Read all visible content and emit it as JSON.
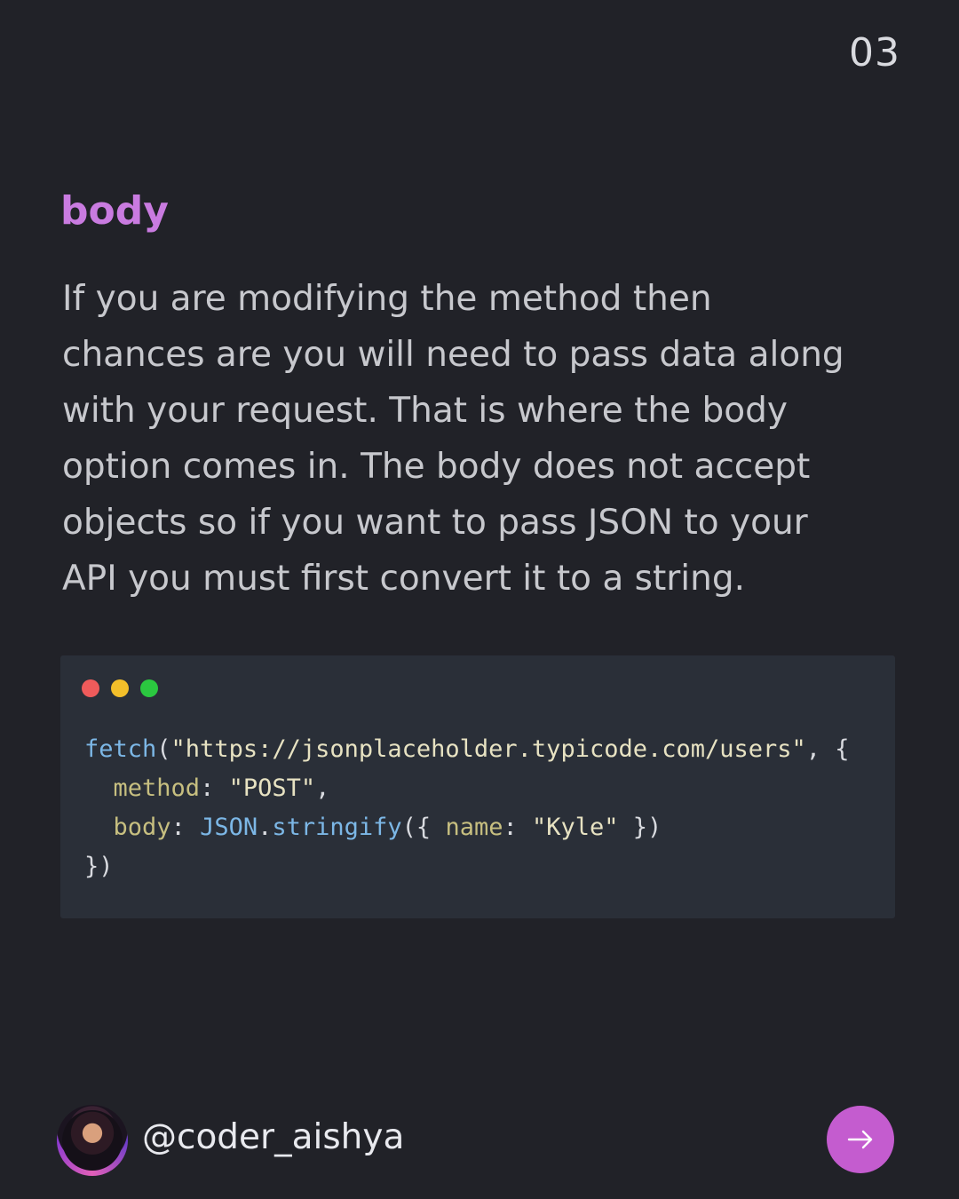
{
  "page_number": "03",
  "section": {
    "title": "body",
    "description_lines": [
      "If you are modifying the method then",
      "chances are you will need to pass data along",
      "with your request. That is where the body",
      "option comes in. The body does not accept",
      "objects so if you want to pass JSON to your",
      "API you must first convert it to a string."
    ]
  },
  "code_window": {
    "controls": [
      "close-dot",
      "minimize-dot",
      "maximize-dot"
    ],
    "colors": {
      "close": "#ef5b5b",
      "minimize": "#f3bf2a",
      "maximize": "#2bc840"
    },
    "lines": {
      "l1": {
        "fn": "fetch",
        "open": "(",
        "url": "\"https://jsonplaceholder.typicode.com/users\"",
        "rest": ", {"
      },
      "l2": {
        "indent": "  ",
        "key": "method",
        "sep": ": ",
        "value": "\"POST\"",
        "end": ","
      },
      "l3": {
        "indent": "  ",
        "key": "body",
        "sep": ": ",
        "obj": "JSON",
        "dot": ".",
        "method": "stringify",
        "open": "({ ",
        "inner_key": "name",
        "inner_sep": ": ",
        "inner_value": "\"Kyle\"",
        "close": " })"
      },
      "l4": {
        "text": "})"
      }
    }
  },
  "footer": {
    "handle": "@coder_aishya",
    "avatar": "profile-avatar",
    "next_icon": "arrow-right-icon",
    "accent": "#c45ccf"
  }
}
